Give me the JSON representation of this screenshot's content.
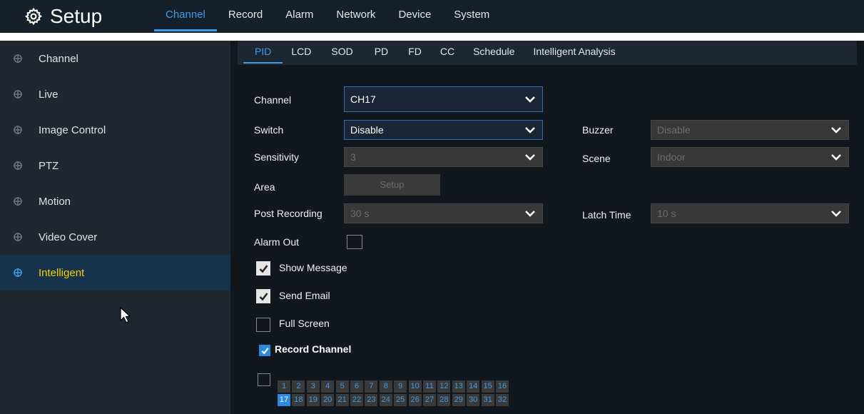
{
  "header": {
    "title": "Setup",
    "tabs": [
      "Channel",
      "Record",
      "Alarm",
      "Network",
      "Device",
      "System"
    ],
    "active_tab": "Channel"
  },
  "sidebar": {
    "items": [
      "Channel",
      "Live",
      "Image Control",
      "PTZ",
      "Motion",
      "Video Cover",
      "Intelligent"
    ],
    "active_item": "Intelligent"
  },
  "subtabs": {
    "items": [
      "PID",
      "LCD",
      "SOD",
      "PD",
      "FD",
      "CC",
      "Schedule",
      "Intelligent Analysis"
    ],
    "active": "PID"
  },
  "form": {
    "channel_label": "Channel",
    "channel_value": "CH17",
    "switch_label": "Switch",
    "switch_value": "Disable",
    "buzzer_label": "Buzzer",
    "buzzer_value": "Disable",
    "sensitivity_label": "Sensitivity",
    "sensitivity_value": "3",
    "scene_label": "Scene",
    "scene_value": "Indoor",
    "area_label": "Area",
    "area_button": "Setup",
    "post_recording_label": "Post Recording",
    "post_recording_value": "30 s",
    "latch_time_label": "Latch Time",
    "latch_time_value": "10 s",
    "alarm_out_label": "Alarm Out",
    "show_message_label": "Show Message",
    "send_email_label": "Send Email",
    "full_screen_label": "Full Screen",
    "record_channel_label": "Record Channel"
  },
  "channels": {
    "row1": [
      "1",
      "2",
      "3",
      "4",
      "5",
      "6",
      "7",
      "8",
      "9",
      "10",
      "11",
      "12",
      "13",
      "14",
      "15",
      "16"
    ],
    "row2": [
      "17",
      "18",
      "19",
      "20",
      "21",
      "22",
      "23",
      "24",
      "25",
      "26",
      "27",
      "28",
      "29",
      "30",
      "31",
      "32"
    ],
    "selected": "17"
  },
  "colors": {
    "accent": "#3d9bea",
    "active_sidebar_text": "#f5d200",
    "top_bar": "#16202b",
    "sidebar": "#20272f",
    "content": "#12171d"
  }
}
